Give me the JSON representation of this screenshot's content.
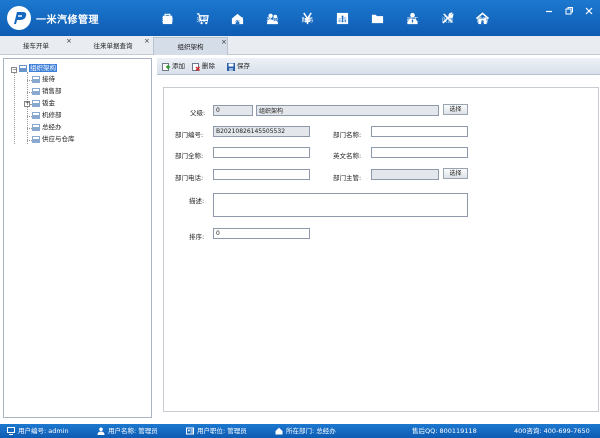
{
  "app": {
    "title": "一米汽修管理"
  },
  "nav": {
    "items": [
      {
        "label": "开单",
        "icon": "bag-icon"
      },
      {
        "label": "采购",
        "icon": "cart-icon"
      },
      {
        "label": "仓库",
        "icon": "house-icon"
      },
      {
        "label": "客户",
        "icon": "users-icon"
      },
      {
        "label": "财务",
        "icon": "yen-icon"
      },
      {
        "label": "报表",
        "icon": "chart-icon"
      },
      {
        "label": "资料",
        "icon": "folder-icon"
      },
      {
        "label": "员工",
        "icon": "employee-icon"
      },
      {
        "label": "设置",
        "icon": "tools-icon"
      },
      {
        "label": "首页",
        "icon": "home-icon"
      }
    ]
  },
  "tabs": [
    {
      "label": "接车开单"
    },
    {
      "label": "往来单据查询"
    },
    {
      "label": "组织架构"
    }
  ],
  "tree": {
    "root": "组织架构",
    "children": [
      "接待",
      "销售部",
      "钣金",
      "机修部",
      "总经办",
      "供应与仓库"
    ]
  },
  "toolbar": {
    "add": "添加",
    "delete": "删除",
    "save": "保存"
  },
  "form": {
    "parent_label": "父级:",
    "parent_id": "0",
    "parent_name": "组织架构",
    "select_label": "选择",
    "dept_code_label": "部门编号:",
    "dept_code": "B20210826145505532",
    "dept_name_label": "部门名称:",
    "dept_name": "",
    "dept_fullname_label": "部门全称:",
    "dept_fullname": "",
    "english_name_label": "英文名称:",
    "english_name": "",
    "dept_phone_label": "部门电话:",
    "dept_phone": "",
    "dept_manager_label": "部门主管:",
    "dept_manager": "",
    "desc_label": "描述:",
    "desc": "",
    "sort_label": "排序:",
    "sort": "0"
  },
  "status": {
    "user_code": "用户编号: admin",
    "user_name": "用户名称: 管理员",
    "user_position": "用户职位: 管理员",
    "user_dept": "所在部门: 总经办",
    "qq": "售后QQ:  800119118",
    "hotline": "400咨询: 400-699-7650"
  },
  "colors": {
    "header": "#1468c2",
    "selected": "#3b7fd9"
  }
}
